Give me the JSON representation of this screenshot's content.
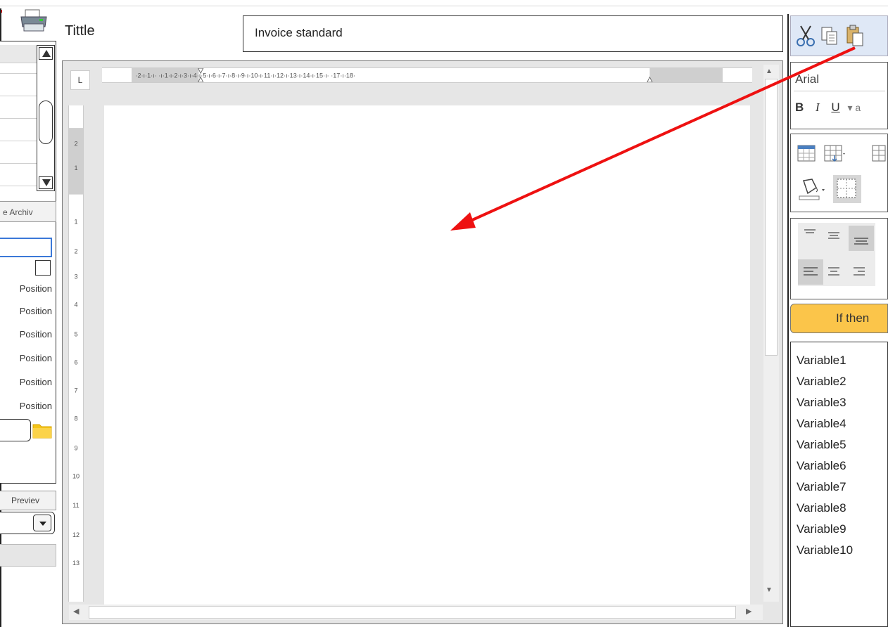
{
  "header": {
    "title_label": "Tittle",
    "title_value": "Invoice standard"
  },
  "left_panel": {
    "tab_label": "e Archiv",
    "position_labels": [
      "Position",
      "Position",
      "Position",
      "Position",
      "Position",
      "Position"
    ],
    "preview_label": "Previev"
  },
  "editor": {
    "corner_label": "L",
    "ruler_h": "·2·ı·1·ı·  ·ı·1·ı·2·ı·3·ı·4·ı·5·ı·6·ı·7·ı·8·ı·9·ı·10·ı·11·ı·12·ı·13·ı·14·ı·15·ı·   ·17·ı·18·",
    "ruler_v": [
      "2",
      "1",
      "1",
      "2",
      "3",
      "4",
      "5",
      "6",
      "7",
      "8",
      "9",
      "10",
      "11",
      "12",
      "13"
    ]
  },
  "right_panel": {
    "font_name": "Arial",
    "bold": "B",
    "italic": "I",
    "underline": "U",
    "more": "▾ a",
    "ifthen_label": "If then",
    "variables": [
      "Variable1",
      "Variable2",
      "Variable3",
      "Variable4",
      "Variable5",
      "Variable6",
      "Variable7",
      "Variable8",
      "Variable9",
      "Variable10"
    ]
  },
  "colors": {
    "accent_blue": "#3b78d8",
    "ifthen_yellow": "#fbc54a",
    "annotation_red": "#ee1111",
    "folder_yellow": "#f5c518"
  },
  "icons": [
    "printer-icon",
    "cut-icon",
    "copy-icon",
    "paste-icon",
    "folder-icon",
    "insert-table-icon",
    "table-grid-icon",
    "fill-color-icon",
    "borders-icon",
    "align-top-icon",
    "align-center-icon",
    "align-left-icon"
  ]
}
